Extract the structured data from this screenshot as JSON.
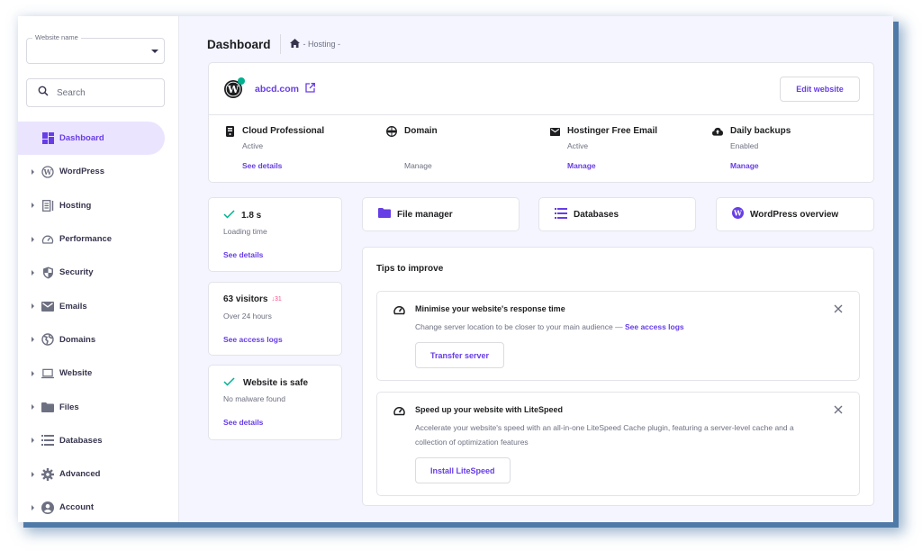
{
  "sidebar": {
    "website_select": {
      "label": "Website name",
      "value": ""
    },
    "search": {
      "placeholder": "Search"
    },
    "items": [
      {
        "label": "Dashboard",
        "icon": "dashboard-icon",
        "active": true
      },
      {
        "label": "WordPress",
        "icon": "wordpress-icon"
      },
      {
        "label": "Hosting",
        "icon": "server-icon"
      },
      {
        "label": "Performance",
        "icon": "speedometer-icon"
      },
      {
        "label": "Security",
        "icon": "shield-icon"
      },
      {
        "label": "Emails",
        "icon": "mail-icon"
      },
      {
        "label": "Domains",
        "icon": "globe-icon"
      },
      {
        "label": "Website",
        "icon": "laptop-icon"
      },
      {
        "label": "Files",
        "icon": "folder-icon"
      },
      {
        "label": "Databases",
        "icon": "database-icon"
      },
      {
        "label": "Advanced",
        "icon": "gear-icon"
      },
      {
        "label": "Account",
        "icon": "account-icon"
      }
    ]
  },
  "header": {
    "title": "Dashboard",
    "breadcrumb": {
      "home_icon": "home-icon",
      "text": "- Hosting -"
    }
  },
  "site": {
    "domain": "abcd.com",
    "status_color": "#00b090",
    "edit_label": "Edit website",
    "services": [
      {
        "title": "Cloud Professional",
        "status": "Active",
        "link": "See details",
        "icon": "server-icon"
      },
      {
        "title": "Domain",
        "status": "",
        "link": "Manage",
        "icon": "www-globe-icon"
      },
      {
        "title": "Hostinger Free Email",
        "status": "Active",
        "link": "Manage",
        "icon": "mail-icon"
      },
      {
        "title": "Daily backups",
        "status": "Enabled",
        "link": "Manage",
        "icon": "cloud-upload-icon"
      }
    ]
  },
  "stats": {
    "loading": {
      "value": "1.8 s",
      "label": "Loading time",
      "link": "See details"
    },
    "visitors": {
      "value": "63 visitors",
      "delta": "↓31",
      "label": "Over 24 hours",
      "link": "See access logs"
    },
    "security": {
      "value": "Website is safe",
      "label": "No malware found",
      "link": "See details"
    }
  },
  "quick_links": [
    {
      "label": "File manager",
      "icon": "folder-icon"
    },
    {
      "label": "Databases",
      "icon": "database-icon"
    },
    {
      "label": "WordPress overview",
      "icon": "wordpress-icon"
    }
  ],
  "tips": {
    "title": "Tips to improve",
    "items": [
      {
        "title": "Minimise your website's response time",
        "text": "Change server location to be closer to your main audience —",
        "link": "See access logs",
        "button": "Transfer server"
      },
      {
        "title": "Speed up your website with LiteSpeed",
        "text": "Accelerate your website's speed with an all-in-one LiteSpeed Cache plugin, featuring a server-level cache and a collection of optimization features",
        "button": "Install LiteSpeed"
      }
    ]
  },
  "colors": {
    "accent": "#673de6",
    "success": "#00b090",
    "danger": "#fc5185",
    "text": "#1d1e20",
    "muted": "#6d7081"
  }
}
